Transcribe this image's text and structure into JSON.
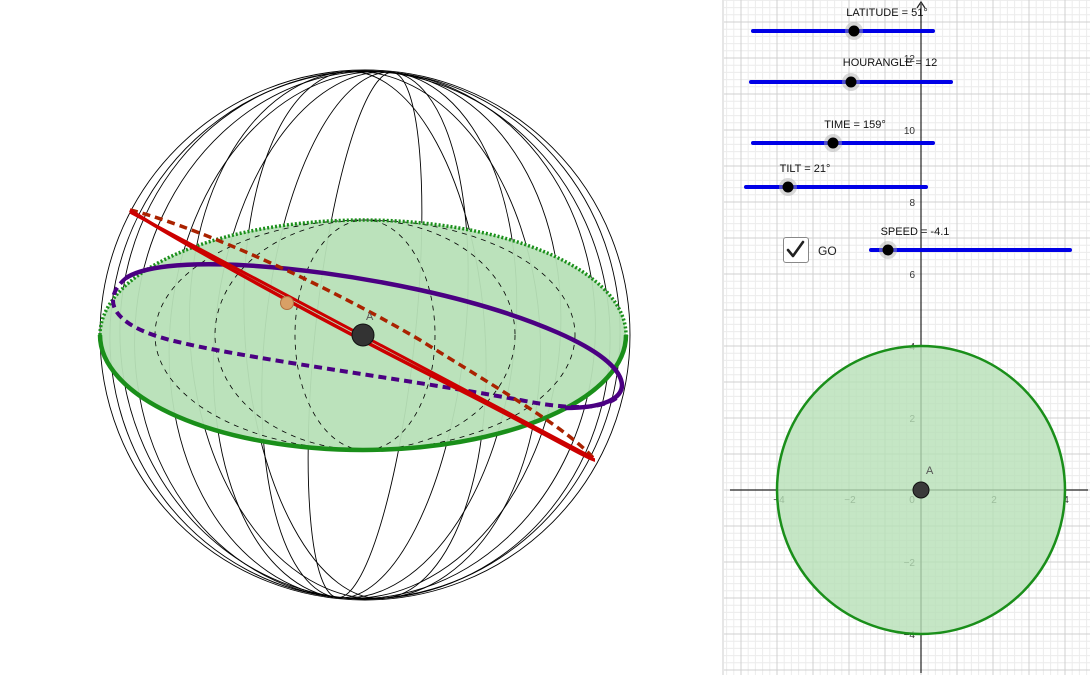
{
  "view3d": {
    "point_label": "A"
  },
  "sliders": [
    {
      "id": "latitude",
      "label": "LATITUDE = 51°"
    },
    {
      "id": "hourangle",
      "label": "HOURANGLE = 12"
    },
    {
      "id": "time",
      "label": "TIME = 159°"
    },
    {
      "id": "tilt",
      "label": "TILT = 21°"
    },
    {
      "id": "speed",
      "label": "SPEED = -4.1"
    }
  ],
  "checkbox": {
    "label": "GO",
    "checked": true
  },
  "graph2d": {
    "x_ticks": [
      "−4",
      "−2",
      "0",
      "2",
      "4"
    ],
    "y_ticks": [
      "12",
      "10",
      "8",
      "6",
      "4",
      "2",
      "−2",
      "−4"
    ],
    "point_label": "A",
    "circle_radius": 4,
    "point_x": 0,
    "point_y": 0
  },
  "colors": {
    "slider": "#0000e6",
    "green_edge": "#1a8f1a",
    "green_fill": "#b7e0b7",
    "red": "#cc0000",
    "purple": "#4b0082",
    "point": "#3a3a3a"
  }
}
